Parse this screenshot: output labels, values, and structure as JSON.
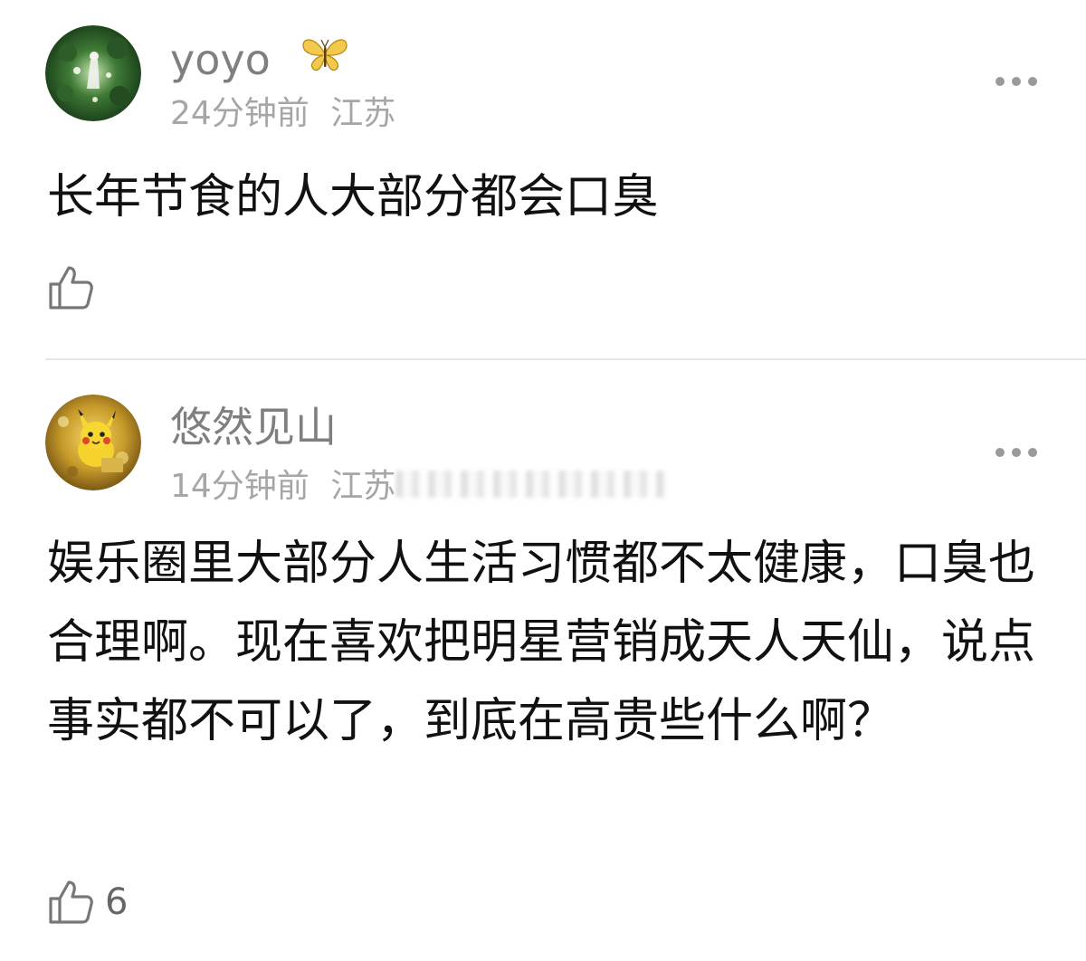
{
  "comments": [
    {
      "username": "yoyo",
      "badge": "butterfly-icon",
      "time": "24分钟前",
      "location": "江苏",
      "text": "长年节食的人大部分都会口臭",
      "likes": ""
    },
    {
      "username": "悠然见山",
      "time": "14分钟前",
      "location": "江苏",
      "text": "娱乐圈里大部分人生活习惯都不太健康，口臭也合理啊。现在喜欢把明星营销成天人天仙，说点事实都不可以了，到底在高贵些什么啊？",
      "likes": "6"
    }
  ],
  "colors": {
    "username": "#7f7f7f",
    "meta": "#a6a6a6",
    "text": "#111111",
    "divider": "#e6e6e6",
    "icon": "#777777"
  }
}
